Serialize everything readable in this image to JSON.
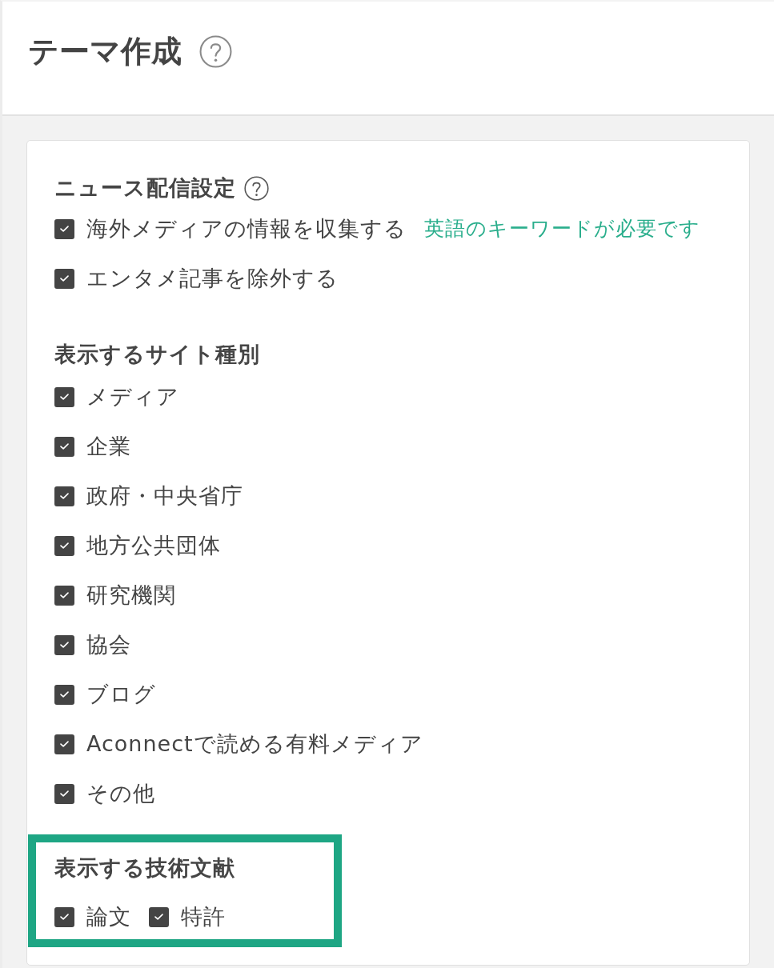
{
  "header": {
    "title": "テーマ作成"
  },
  "sections": [
    {
      "title": "ニュース配信設定",
      "help": true,
      "kind": "list",
      "highlighted": false,
      "options": [
        {
          "label": "海外メディアの情報を収集する",
          "checked": true,
          "note": "英語のキーワードが必要です"
        },
        {
          "label": "エンタメ記事を除外する",
          "checked": true
        }
      ]
    },
    {
      "title": "表示するサイト種別",
      "help": false,
      "kind": "list",
      "highlighted": false,
      "options": [
        {
          "label": "メディア",
          "checked": true
        },
        {
          "label": "企業",
          "checked": true
        },
        {
          "label": "政府・中央省庁",
          "checked": true
        },
        {
          "label": "地方公共団体",
          "checked": true
        },
        {
          "label": "研究機関",
          "checked": true
        },
        {
          "label": "協会",
          "checked": true
        },
        {
          "label": "ブログ",
          "checked": true
        },
        {
          "label": "Aconnectで読める有料メディア",
          "checked": true
        },
        {
          "label": "その他",
          "checked": true
        }
      ]
    },
    {
      "title": "表示する技術文献",
      "help": false,
      "kind": "inline",
      "highlighted": true,
      "options": [
        {
          "label": "論文",
          "checked": true
        },
        {
          "label": "特許",
          "checked": true
        }
      ]
    }
  ]
}
